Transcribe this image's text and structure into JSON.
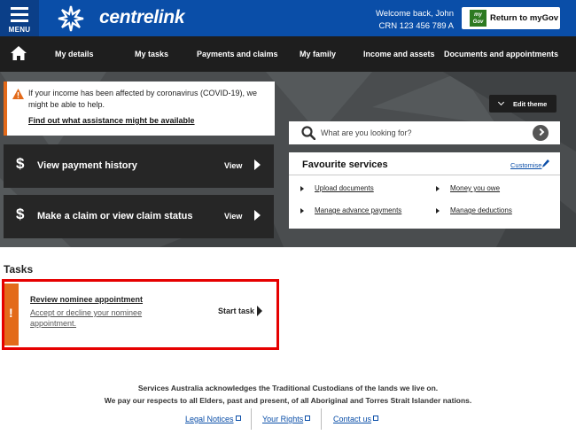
{
  "header": {
    "menu_label": "MENU",
    "brand": "centrelink",
    "welcome_line": "Welcome back,   John",
    "crn_line": "CRN 123 456 789 A",
    "mygov_logo_text": "my Gov",
    "return_label": "Return to myGov"
  },
  "nav": {
    "items": [
      "My details",
      "My tasks",
      "Payments and claims",
      "My family",
      "Income and assets",
      "Documents and appointments"
    ]
  },
  "alert": {
    "message": "If your income has been affected by coronavirus (COVID-19), we might be able to help.",
    "link": "Find out what assistance might be available"
  },
  "actions": [
    {
      "symbol": "$",
      "title": "View payment history",
      "view_label": "View"
    },
    {
      "symbol": "$",
      "title": "Make a claim or view claim status",
      "view_label": "View"
    }
  ],
  "edit_theme_label": "Edit theme",
  "search": {
    "placeholder": "What are you looking for?"
  },
  "favourites": {
    "title": "Favourite services",
    "customise_label": "Customise",
    "links": [
      "Upload documents",
      "Money you owe",
      "Manage advance payments",
      "Manage deductions"
    ]
  },
  "tasks": {
    "heading": "Tasks",
    "items": [
      {
        "marker": "!",
        "title": "Review nominee appointment",
        "description": "Accept or decline your nominee appointment.",
        "action_label": "Start task"
      }
    ]
  },
  "footer": {
    "ack_line1": "Services Australia acknowledges the Traditional Custodians of the lands we live on.",
    "ack_line2": "We pay our respects to all Elders, past and present, of all Aboriginal and Torres Strait Islander nations.",
    "links": [
      "Legal Notices",
      "Your Rights",
      "Contact us"
    ]
  },
  "colors": {
    "header_blue": "#0a4ea8",
    "nav_dark": "#1e1e1e",
    "alert_orange": "#e36a1a",
    "highlight_red": "#e60000",
    "mygov_green": "#2d7a21"
  }
}
